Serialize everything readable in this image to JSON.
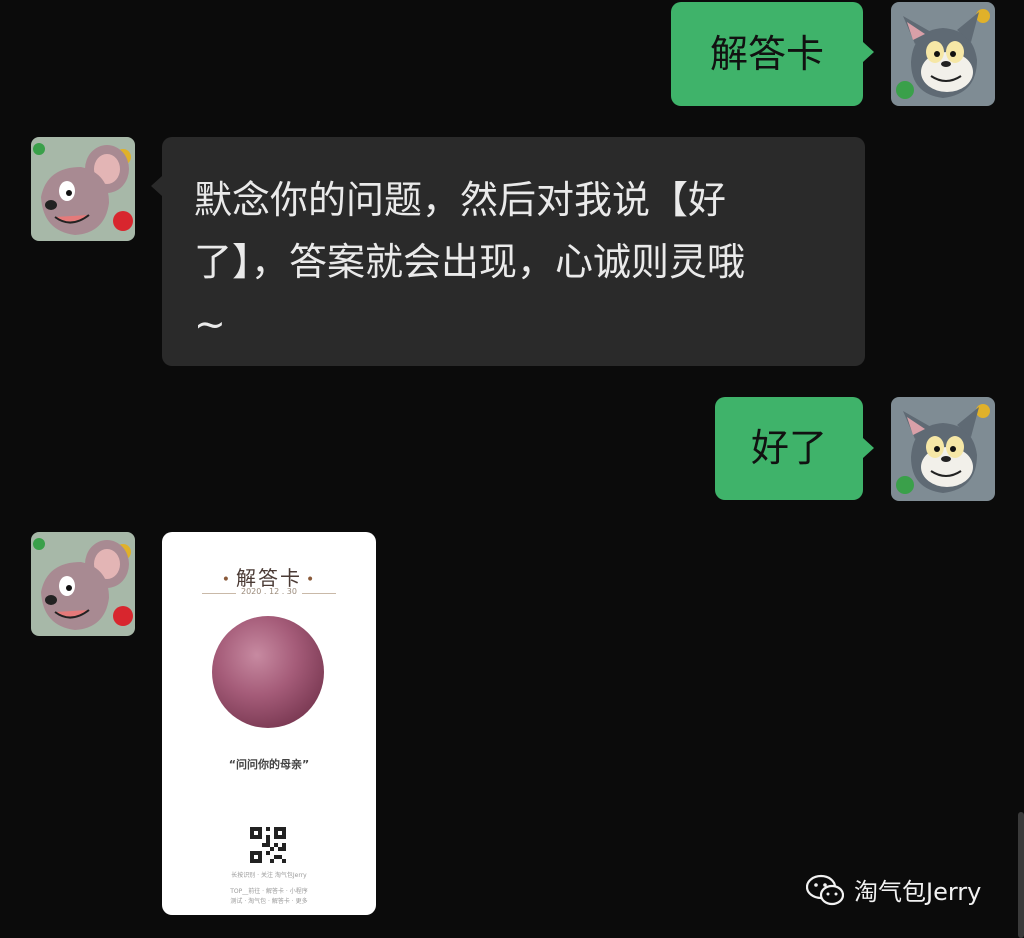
{
  "messages": [
    {
      "side": "sent",
      "text": "解答卡"
    },
    {
      "side": "received",
      "lines": [
        "默念你的问题，然后对我说【好",
        "了】，答案就会出现，心诚则灵哦",
        "~"
      ]
    },
    {
      "side": "sent",
      "text": "好了"
    },
    {
      "side": "received",
      "type": "image-card"
    }
  ],
  "card": {
    "title": "解答卡",
    "date": "2020 . 12 . 30",
    "answer": "“问问你的母亲”",
    "meta_line1": "长按识别 · 关注 淘气包Jerry",
    "meta_line2": "TOP__前往 · 解答卡 · 小程序",
    "meta_line3": "测试 · 淘气包 · 解答卡 · 更多"
  },
  "watermark": {
    "icon": "wechat-icon",
    "text": "淘气包Jerry"
  },
  "colors": {
    "background": "#0b0b0b",
    "sent_bubble": "#3fb36a",
    "received_bubble": "#2a2a2a"
  }
}
